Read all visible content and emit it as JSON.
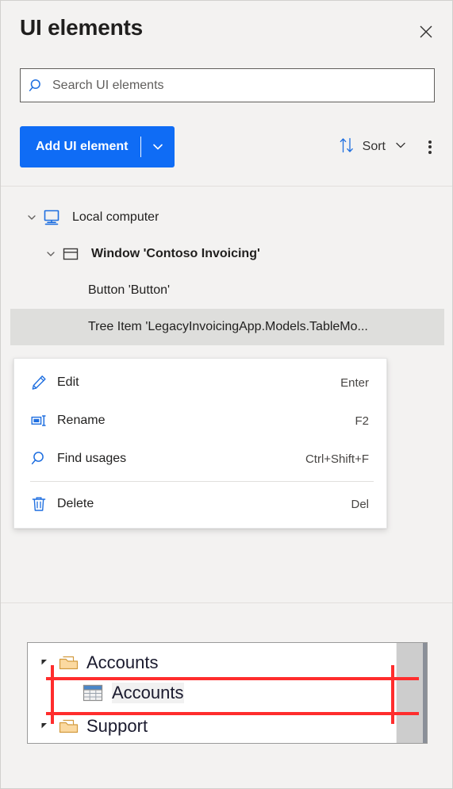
{
  "header": {
    "title": "UI elements",
    "close_icon": "close-icon"
  },
  "search": {
    "placeholder": "Search UI elements",
    "value": "",
    "icon": "search-icon"
  },
  "toolbar": {
    "add_label": "Add UI element",
    "add_caret_icon": "chevron-down-icon",
    "sort_label": "Sort",
    "sort_icon": "sort-arrows-icon",
    "sort_caret_icon": "chevron-down-icon",
    "more_label": "More options",
    "more_icon": "more-vertical-icon",
    "accent_color": "#0f6cf5"
  },
  "tree": {
    "items": [
      {
        "label": "Local computer",
        "icon": "monitor-icon",
        "chevron": "chevron-down-icon",
        "expanded": true,
        "indent": 0,
        "bold": false,
        "selected": false
      },
      {
        "label": "Window 'Contoso Invoicing'",
        "icon": "window-icon",
        "chevron": "chevron-down-icon",
        "expanded": true,
        "indent": 1,
        "bold": true,
        "selected": false
      },
      {
        "label": "Button 'Button'",
        "icon": "",
        "chevron": "",
        "expanded": false,
        "indent": 2,
        "bold": false,
        "selected": false
      },
      {
        "label": "Tree Item 'LegacyInvoicingApp.Models.TableMo...",
        "icon": "",
        "chevron": "",
        "expanded": false,
        "indent": 2,
        "bold": false,
        "selected": true
      }
    ],
    "selected_bg": "#dededc"
  },
  "context_menu": {
    "items": [
      {
        "label": "Edit",
        "shortcut": "Enter",
        "icon": "pencil-icon",
        "separator_after": false
      },
      {
        "label": "Rename",
        "shortcut": "F2",
        "icon": "rename-icon",
        "separator_after": false
      },
      {
        "label": "Find usages",
        "shortcut": "Ctrl+Shift+F",
        "icon": "search-icon",
        "separator_after": true
      },
      {
        "label": "Delete",
        "shortcut": "Del",
        "icon": "trash-icon",
        "separator_after": false
      }
    ]
  },
  "preview": {
    "rows": [
      {
        "label": "Accounts",
        "icon": "folder-icon",
        "triangle": "collapse-triangle-icon",
        "indent": 0
      },
      {
        "label": "Accounts",
        "icon": "table-icon",
        "triangle": "",
        "indent": 1
      },
      {
        "label": "Support",
        "icon": "folder-icon",
        "triangle": "collapse-triangle-icon",
        "indent": 0
      }
    ],
    "highlight_color": "#ff2d2d"
  }
}
